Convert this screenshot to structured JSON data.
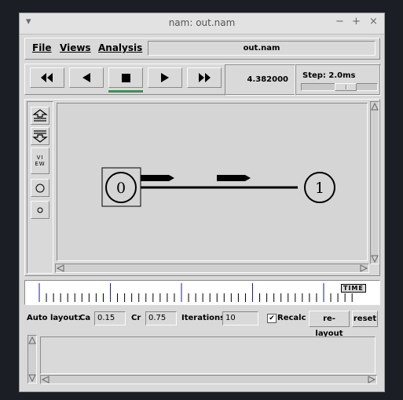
{
  "window": {
    "title": "nam: out.nam"
  },
  "titlebar_buttons": {
    "menu": "▾",
    "minimize": "−",
    "maximize": "+",
    "close": "×"
  },
  "menu": {
    "file": "File",
    "views": "Views",
    "analysis": "Analysis"
  },
  "file_display": "out.nam",
  "transport": {
    "time": "4.382000",
    "step_label": "Step: 2.0ms"
  },
  "view_button_label": "VIEW",
  "canvas": {
    "nodes": [
      {
        "label": "0"
      },
      {
        "label": "1"
      }
    ]
  },
  "timeline": {
    "label": "TIME"
  },
  "auto_layout": {
    "label": "Auto layout:",
    "ca_label": "Ca",
    "ca_value": "0.15",
    "cr_label": "Cr",
    "cr_value": "0.75",
    "iterations_label": "Iterations",
    "iterations_value": "10",
    "recalc_label": "Recalc",
    "recalc_checked": true,
    "relayout_label": "re-layout",
    "reset_label": "reset"
  },
  "colors": {
    "stop_indicator": "#3d8f56"
  }
}
